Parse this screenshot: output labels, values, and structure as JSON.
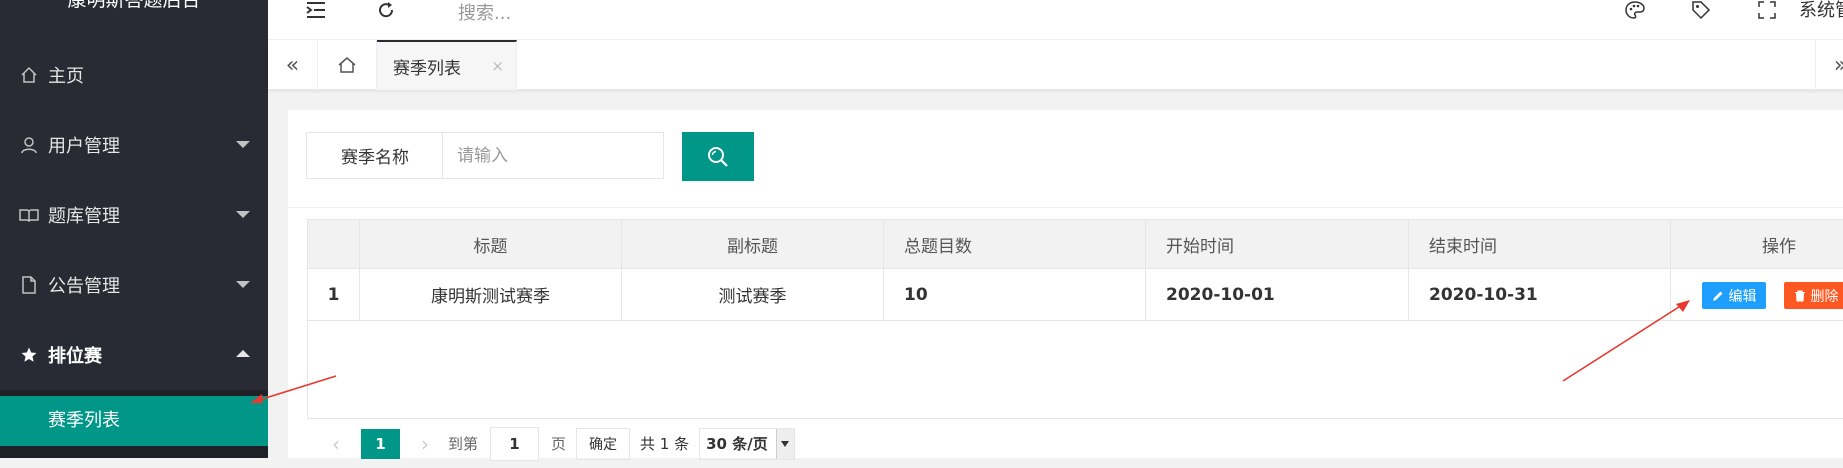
{
  "app": {
    "brand": "康明斯答题后台"
  },
  "sidebar": {
    "items": [
      {
        "label": "主页",
        "icon": "home-icon"
      },
      {
        "label": "用户管理",
        "icon": "user-icon"
      },
      {
        "label": "题库管理",
        "icon": "book-icon"
      },
      {
        "label": "公告管理",
        "icon": "document-icon"
      },
      {
        "label": "排位赛",
        "icon": "star-icon"
      }
    ],
    "sub_item": "赛季列表"
  },
  "header": {
    "search_placeholder": "搜索...",
    "system_label": "系统管"
  },
  "tabs": {
    "active_label": "赛季列表",
    "close": "×"
  },
  "search_form": {
    "label": "赛季名称",
    "placeholder": "请输入"
  },
  "table": {
    "headers": [
      "",
      "标题",
      "副标题",
      "总题目数",
      "开始时间",
      "结束时间",
      "操作"
    ],
    "rows": [
      {
        "index": "1",
        "title": "康明斯测试赛季",
        "subtitle": "测试赛季",
        "total": "10",
        "start": "2020-10-01",
        "end": "2020-10-31"
      }
    ],
    "edit_label": "编辑",
    "delete_label": "删除"
  },
  "pager": {
    "current": "1",
    "goto_prefix": "到第",
    "goto_value": "1",
    "page_suffix": "页",
    "confirm": "确定",
    "total": "共 1 条",
    "page_size": "30 条/页"
  },
  "colors": {
    "sidebar_bg": "#282b33",
    "accent": "#009688",
    "edit": "#1e9fff",
    "delete": "#ff5722",
    "annotation": "#e8382f"
  }
}
